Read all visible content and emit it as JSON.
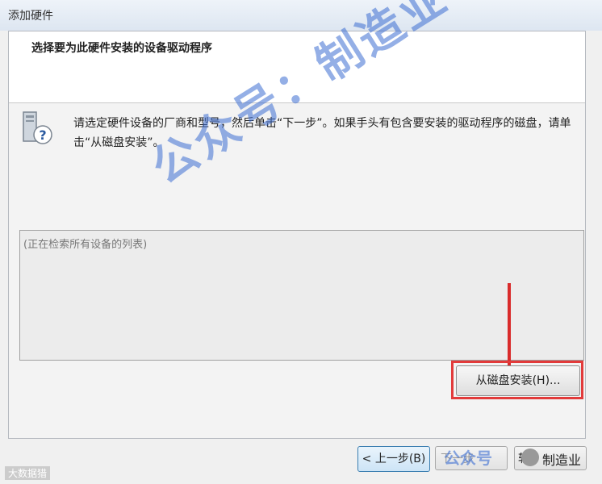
{
  "window": {
    "title": "添加硬件"
  },
  "header": {
    "heading": "选择要为此硬件安装的设备驱动程序"
  },
  "body": {
    "instruction": "请选定硬件设备的厂商和型号，然后单击“下一步”。如果手头有包含要安装的驱动程序的磁盘，请单击“从磁盘安装”。",
    "list_status": "(正在检索所有设备的列表)",
    "disk_button": "从磁盘安装(H)..."
  },
  "footer": {
    "back": "< 上一步(B)",
    "next": "下一步",
    "cancel": "软"
  },
  "watermarks": {
    "center": "公众号：制造业",
    "bottom_left": "大数据猎",
    "bottom_right": "公众号",
    "brand": "制造业"
  },
  "icons": {
    "info": "computer-question-icon",
    "wechat": "wechat-icon"
  },
  "colors": {
    "highlight": "#e23b3b",
    "watermark": "#3c6ed2"
  }
}
